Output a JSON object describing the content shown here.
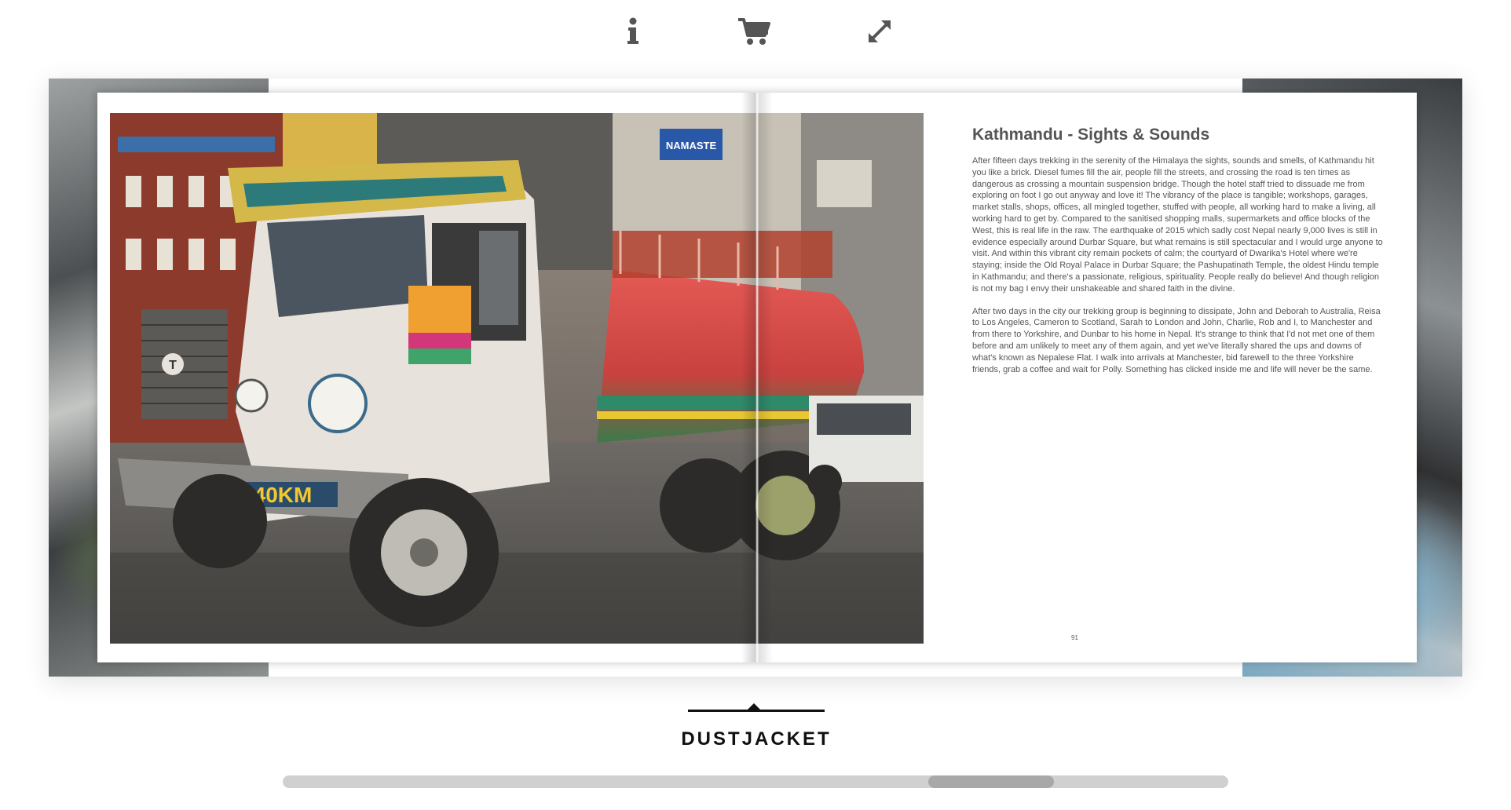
{
  "toolbar": {
    "info_icon": "info-icon",
    "cart_icon": "cart-icon",
    "fullscreen_icon": "expand-icon"
  },
  "book": {
    "right_page": {
      "title": "Kathmandu - Sights & Sounds",
      "paragraphs": [
        "After fifteen days trekking in the serenity of the Himalaya the sights, sounds and smells, of Kathmandu hit you like a brick. Diesel fumes fill the air, people fill the streets, and crossing the road is ten times as dangerous as crossing a mountain suspension bridge. Though the hotel staff tried to dissuade me from exploring on foot I go out anyway and love it! The vibrancy of the place is tangible; workshops, garages, market stalls, shops, offices, all mingled together, stuffed with people, all working hard to make a living, all working hard to get by. Compared to the sanitised shopping malls, supermarkets and office blocks of the West, this is real life in the raw. The earthquake of 2015 which sadly cost Nepal nearly 9,000 lives is still in evidence especially around Durbar Square, but what remains is still spectacular and I would urge anyone to visit. And within this vibrant city remain pockets of calm; the courtyard of Dwarika's Hotel where we're staying; inside the Old Royal Palace in Durbar Square; the Pashupatinath Temple, the oldest Hindu temple in Kathmandu; and there's a passionate, religious, spirituality. People really do believe! And though religion is not my bag I envy their unshakeable and shared faith in the divine.",
        "After two days in the city our trekking group is beginning to dissipate, John and Deborah to Australia, Reisa to Los Angeles, Cameron to Scotland, Sarah to London and John, Charlie, Rob and I, to Manchester and from there to Yorkshire, and Dunbar to his home in Nepal. It's strange to think that I'd not met one of them before and am unlikely to meet any of them again, and yet we've literally shared the ups and downs of what's known as Nepalese Flat. I walk into arrivals at Manchester, bid farewell to the three Yorkshire friends, grab a coffee and wait for Polly. Something has clicked inside me and life will never be the same."
      ],
      "page_number": "91"
    },
    "photo": {
      "signs": [
        "NAMASTE",
        "40KM"
      ]
    }
  },
  "section": {
    "label": "DUSTJACKET"
  },
  "scroll": {
    "position_fraction": 0.68
  }
}
